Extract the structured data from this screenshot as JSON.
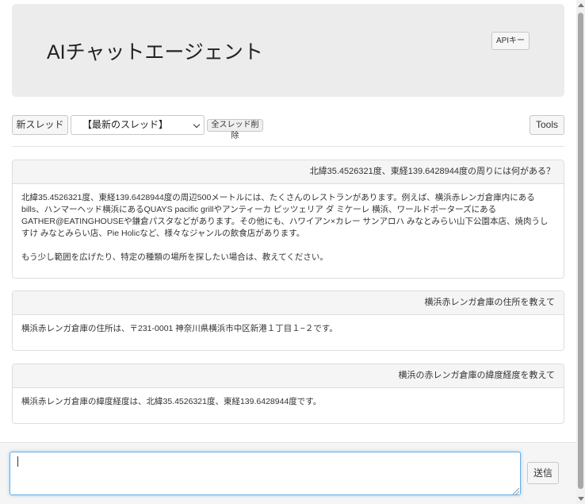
{
  "header": {
    "title": "AIチャットエージェント",
    "api_key_label": "APIキー"
  },
  "toolbar": {
    "new_thread_label": "新スレッド",
    "thread_select_value": "【最新のスレッド】",
    "delete_all_label": "全スレッド削除",
    "tools_label": "Tools"
  },
  "messages": [
    {
      "question": "北緯35.4526321度、東経139.6428944度の周りには何がある？",
      "answer_paragraphs": [
        "北緯35.4526321度、東経139.6428944度の周辺500メートルには、たくさんのレストランがあります。例えば、横浜赤レンガ倉庫内にあるbills、ハンマーヘッド横浜にあるQUAYS pacific grillやアンティーカ ピッツェリア ダ ミケーレ 横浜、ワールドポーターズにあるGATHER@EATINGHOUSEや鎌倉パスタなどがあります。その他にも、ハワイアン×カレー サンアロハ みなとみらい山下公園本店、焼肉うしすけ みなとみらい店、Pie Holicなど、様々なジャンルの飲食店があります。",
        "もう少し範囲を広げたり、特定の種類の場所を探したい場合は、教えてください。"
      ]
    },
    {
      "question": "横浜赤レンガ倉庫の住所を教えて",
      "answer_paragraphs": [
        "横浜赤レンガ倉庫の住所は、〒231-0001 神奈川県横浜市中区新港１丁目１−２です。"
      ]
    },
    {
      "question": "横浜の赤レンガ倉庫の緯度経度を教えて",
      "answer_paragraphs": [
        "横浜赤レンガ倉庫の緯度経度は、北緯35.4526321度、東経139.6428944度です。"
      ]
    }
  ],
  "composer": {
    "input_value": "",
    "send_label": "送信"
  },
  "colors": {
    "header_bg": "#ececec",
    "card_header_bg": "#f5f5f5",
    "input_focus_border": "#66afe9"
  }
}
